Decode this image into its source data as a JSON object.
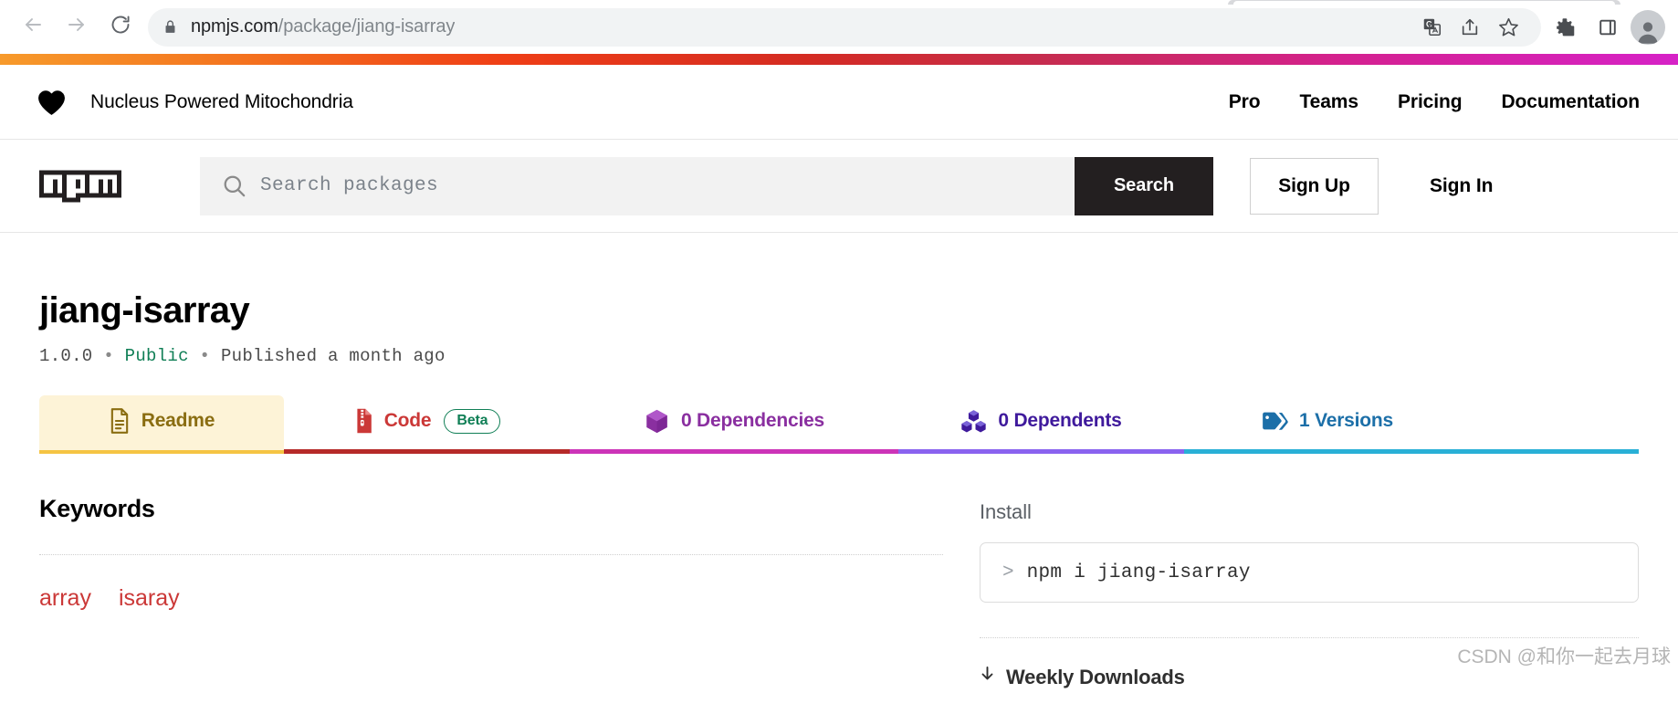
{
  "browser": {
    "back_icon": "back-arrow-icon",
    "forward_icon": "forward-arrow-icon",
    "reload_icon": "reload-icon",
    "lock_icon": "lock-icon",
    "url_domain": "npmjs.com",
    "url_path": "/package/jiang-isarray",
    "url_full": "npmjs.com/package/jiang-isarray",
    "actions": [
      {
        "name": "translate-icon",
        "label": "Translate this page"
      },
      {
        "name": "share-icon",
        "label": "Share this page"
      },
      {
        "name": "bookmark-star-icon",
        "label": "Bookmark this tab"
      }
    ],
    "chrome_actions": [
      {
        "name": "extensions-puzzle-icon",
        "label": "Extensions"
      },
      {
        "name": "side-panel-icon",
        "label": "Side panel"
      },
      {
        "name": "profile-avatar-icon",
        "label": "Profile"
      }
    ]
  },
  "gradient": {
    "start": "#f79a2b",
    "mid": "#d42b22",
    "end": "#d622c7"
  },
  "topnav": {
    "heart_icon": "heart-icon",
    "banner_text": "Nucleus Powered Mitochondria",
    "links": [
      {
        "label": "Pro"
      },
      {
        "label": "Teams"
      },
      {
        "label": "Pricing"
      },
      {
        "label": "Documentation"
      }
    ]
  },
  "searchbar": {
    "logo_alt": "npm",
    "search_icon": "search-icon",
    "placeholder": "Search packages",
    "value": "",
    "submit_label": "Search",
    "signup_label": "Sign Up",
    "signin_label": "Sign In"
  },
  "package": {
    "name": "jiang-isarray",
    "version": "1.0.0",
    "visibility": "Public",
    "published": "Published a month ago",
    "separator": "•"
  },
  "tabs": [
    {
      "label": "Readme",
      "icon": "document-icon",
      "badge": null,
      "active": true,
      "color": "#8a6d11",
      "underline": "#f5c443"
    },
    {
      "label": "Code",
      "icon": "zip-file-icon",
      "badge": "Beta",
      "active": false,
      "color": "#cb3837",
      "underline": "#b62a29"
    },
    {
      "label": "0 Dependencies",
      "icon": "package-box-icon",
      "badge": null,
      "active": false,
      "color": "#8a2fa0",
      "underline": "#cc34b8"
    },
    {
      "label": "0 Dependents",
      "icon": "blocks-icon",
      "badge": null,
      "active": false,
      "color": "#3f1a9c",
      "underline": "#8a63ef"
    },
    {
      "label": "1 Versions",
      "icon": "tag-icon",
      "badge": null,
      "active": false,
      "color": "#1c6fa8",
      "underline": "#29b0d6"
    }
  ],
  "keywords": {
    "heading": "Keywords",
    "items": [
      {
        "label": "array"
      },
      {
        "label": "isaray"
      }
    ]
  },
  "sidebar": {
    "install_label": "Install",
    "install_prompt": ">",
    "install_command": "npm i jiang-isarray",
    "weekly_downloads_label": "Weekly Downloads",
    "download_icon": "download-arrow-icon"
  },
  "watermark": "CSDN @和你一起去月球"
}
